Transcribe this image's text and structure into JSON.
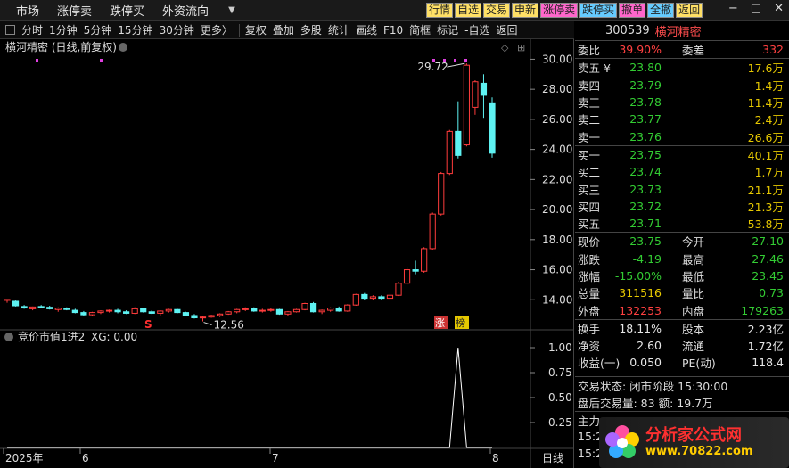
{
  "menus": [
    "市场",
    "涨停卖",
    "跌停买",
    "外资流向"
  ],
  "top_buttons": [
    {
      "label": "行情",
      "bg": "#ffe066"
    },
    {
      "label": "自选",
      "bg": "#ffe066"
    },
    {
      "label": "交易",
      "bg": "#ffe066"
    },
    {
      "label": "申新",
      "bg": "#ffe066"
    },
    {
      "label": "涨停卖",
      "bg": "#ff66cc"
    },
    {
      "label": "跌停买",
      "bg": "#66ccff"
    },
    {
      "label": "撤单",
      "bg": "#ff66cc"
    },
    {
      "label": "全撤",
      "bg": "#66ccff"
    },
    {
      "label": "返回",
      "bg": "#ffe066"
    }
  ],
  "window_controls": [
    "−",
    "□",
    "✕"
  ],
  "toolbar": [
    "分时",
    "1分钟",
    "5分钟",
    "15分钟",
    "30分钟",
    "更多〉",
    "复权",
    "叠加",
    "多股",
    "统计",
    "画线",
    "F10",
    "简框",
    "标记",
    "-自选",
    "返回"
  ],
  "main_chart": {
    "title": "横河精密 (日线,前复权)",
    "y_ticks": [
      "30.00",
      "28.00",
      "26.00",
      "24.00",
      "22.00",
      "20.00",
      "18.00",
      "16.00",
      "14.00"
    ],
    "high_label": "29.72",
    "low_label": "12.56",
    "markers": {
      "s": "S",
      "zhang": "涨",
      "bang": "榜"
    }
  },
  "indicator": {
    "title": "竞价市值1进2",
    "xg_label": "XG: 0.00",
    "y_ticks": [
      "1.00",
      "0.75",
      "0.50",
      "0.25"
    ]
  },
  "x_axis": {
    "labels": [
      "2025年",
      "6",
      "7",
      "8"
    ],
    "period": "日线"
  },
  "chart_data": {
    "type": "candlestick",
    "ylim": [
      12.0,
      30.5
    ],
    "candles": [
      [
        14.0,
        14.02,
        13.8,
        14.02
      ],
      [
        13.9,
        13.95,
        13.55,
        13.6
      ],
      [
        13.55,
        13.65,
        13.4,
        13.45
      ],
      [
        13.4,
        13.55,
        13.3,
        13.52
      ],
      [
        13.55,
        13.65,
        13.45,
        13.5
      ],
      [
        13.5,
        13.6,
        13.35,
        13.4
      ],
      [
        13.35,
        13.5,
        13.2,
        13.45
      ],
      [
        13.45,
        13.5,
        13.3,
        13.35
      ],
      [
        13.3,
        13.4,
        13.1,
        13.15
      ],
      [
        13.15,
        13.25,
        12.95,
        13.0
      ],
      [
        13.0,
        13.2,
        12.9,
        13.15
      ],
      [
        13.15,
        13.3,
        13.05,
        13.25
      ],
      [
        13.25,
        13.35,
        13.15,
        13.3
      ],
      [
        13.3,
        13.4,
        13.1,
        13.2
      ],
      [
        13.2,
        13.3,
        13.05,
        13.1
      ],
      [
        13.1,
        13.5,
        13.05,
        13.4
      ],
      [
        13.4,
        13.45,
        13.15,
        13.2
      ],
      [
        13.2,
        13.3,
        13.05,
        13.1
      ],
      [
        13.1,
        13.3,
        12.95,
        13.25
      ],
      [
        13.25,
        13.4,
        13.15,
        13.35
      ],
      [
        13.35,
        13.4,
        13.1,
        13.15
      ],
      [
        13.15,
        13.2,
        12.9,
        12.95
      ],
      [
        12.95,
        13.05,
        12.75,
        12.8
      ],
      [
        12.8,
        12.9,
        12.56,
        12.85
      ],
      [
        12.85,
        13.0,
        12.8,
        12.95
      ],
      [
        12.95,
        13.1,
        12.85,
        13.05
      ],
      [
        13.05,
        13.25,
        13.0,
        13.2
      ],
      [
        13.2,
        13.4,
        13.1,
        13.35
      ],
      [
        13.35,
        13.5,
        13.25,
        13.4
      ],
      [
        13.4,
        13.5,
        13.2,
        13.25
      ],
      [
        13.25,
        13.4,
        13.15,
        13.3
      ],
      [
        13.3,
        13.45,
        13.2,
        13.35
      ],
      [
        13.35,
        13.4,
        13.0,
        13.05
      ],
      [
        13.05,
        13.25,
        12.95,
        13.2
      ],
      [
        13.2,
        13.4,
        13.15,
        13.35
      ],
      [
        13.35,
        13.8,
        13.3,
        13.75
      ],
      [
        13.75,
        13.85,
        13.15,
        13.2
      ],
      [
        13.2,
        13.35,
        13.05,
        13.3
      ],
      [
        13.3,
        13.5,
        13.2,
        13.45
      ],
      [
        13.45,
        13.55,
        13.2,
        13.25
      ],
      [
        13.25,
        13.7,
        13.2,
        13.65
      ],
      [
        13.65,
        14.4,
        13.6,
        14.35
      ],
      [
        14.35,
        14.45,
        14.0,
        14.1
      ],
      [
        14.1,
        14.3,
        14.0,
        14.2
      ],
      [
        14.2,
        14.3,
        14.0,
        14.1
      ],
      [
        14.1,
        14.4,
        14.05,
        14.3
      ],
      [
        14.3,
        15.2,
        14.25,
        15.1
      ],
      [
        15.1,
        16.2,
        15.0,
        16.0
      ],
      [
        16.0,
        16.6,
        15.7,
        15.9
      ],
      [
        15.9,
        17.5,
        15.8,
        17.4
      ],
      [
        17.4,
        19.8,
        17.3,
        19.7
      ],
      [
        19.7,
        22.5,
        19.6,
        22.4
      ],
      [
        22.4,
        25.3,
        22.3,
        25.2
      ],
      [
        25.2,
        27.2,
        23.4,
        23.6
      ],
      [
        24.3,
        29.72,
        24.2,
        29.6
      ],
      [
        26.8,
        28.6,
        26.3,
        28.5
      ],
      [
        28.4,
        29.0,
        26.1,
        27.6
      ],
      [
        27.1,
        27.46,
        23.45,
        23.75
      ]
    ],
    "indicator_series": [
      0,
      0,
      0,
      0,
      0,
      0,
      0,
      0,
      0,
      0,
      0,
      0,
      0,
      0,
      0,
      0,
      0,
      0,
      0,
      0,
      0,
      0,
      0,
      0,
      0,
      0,
      0,
      0,
      0,
      0,
      0,
      0,
      0,
      0,
      0,
      0,
      0,
      0,
      0,
      0,
      0,
      0,
      0,
      0,
      0,
      0,
      0,
      0,
      0,
      0,
      0,
      0,
      0,
      1,
      0,
      0,
      0,
      0
    ]
  },
  "quote": {
    "code": "300539",
    "name": "横河精密",
    "weibi_label": "委比",
    "weibi": "39.90%",
    "weicha_label": "委差",
    "weicha": "332",
    "asks": [
      {
        "label": "卖五 ¥",
        "price": "23.80",
        "vol": "17.6万"
      },
      {
        "label": "卖四",
        "price": "23.79",
        "vol": "1.4万"
      },
      {
        "label": "卖三",
        "price": "23.78",
        "vol": "11.4万"
      },
      {
        "label": "卖二",
        "price": "23.77",
        "vol": "2.4万"
      },
      {
        "label": "卖一",
        "price": "23.76",
        "vol": "26.6万"
      }
    ],
    "bids": [
      {
        "label": "买一",
        "price": "23.75",
        "vol": "40.1万"
      },
      {
        "label": "买二",
        "price": "23.74",
        "vol": "1.7万"
      },
      {
        "label": "买三",
        "price": "23.73",
        "vol": "21.1万"
      },
      {
        "label": "买四",
        "price": "23.72",
        "vol": "21.3万"
      },
      {
        "label": "买五",
        "price": "23.71",
        "vol": "53.8万"
      }
    ],
    "stats": [
      {
        "l1": "现价",
        "v1": "23.75",
        "c1": "green",
        "l2": "今开",
        "v2": "27.10",
        "c2": "green"
      },
      {
        "l1": "涨跌",
        "v1": "-4.19",
        "c1": "green",
        "l2": "最高",
        "v2": "27.46",
        "c2": "green"
      },
      {
        "l1": "涨幅",
        "v1": "-15.00%",
        "c1": "green",
        "l2": "最低",
        "v2": "23.45",
        "c2": "green"
      },
      {
        "l1": "总量",
        "v1": "311516",
        "c1": "yellow",
        "l2": "量比",
        "v2": "0.73",
        "c2": "green"
      },
      {
        "l1": "外盘",
        "v1": "132253",
        "c1": "red",
        "l2": "内盘",
        "v2": "179263",
        "c2": "green"
      }
    ],
    "fundamentals": [
      {
        "l1": "换手",
        "v1": "18.11%",
        "l2": "股本",
        "v2": "2.23亿"
      },
      {
        "l1": "净资",
        "v1": "2.60",
        "l2": "流通",
        "v2": "1.72亿"
      },
      {
        "l1": "收益(一)",
        "v1": "0.050",
        "l2": "PE(动)",
        "v2": "118.4"
      }
    ],
    "status_lines": [
      "交易状态: 闭市阶段 15:30:00",
      "盘后交易量: 83  额: 19.7万"
    ],
    "partial": [
      "主力",
      "15:2",
      "15:2"
    ]
  },
  "logo": {
    "line1": "分析家公式网",
    "line2": "www.70822.com"
  }
}
